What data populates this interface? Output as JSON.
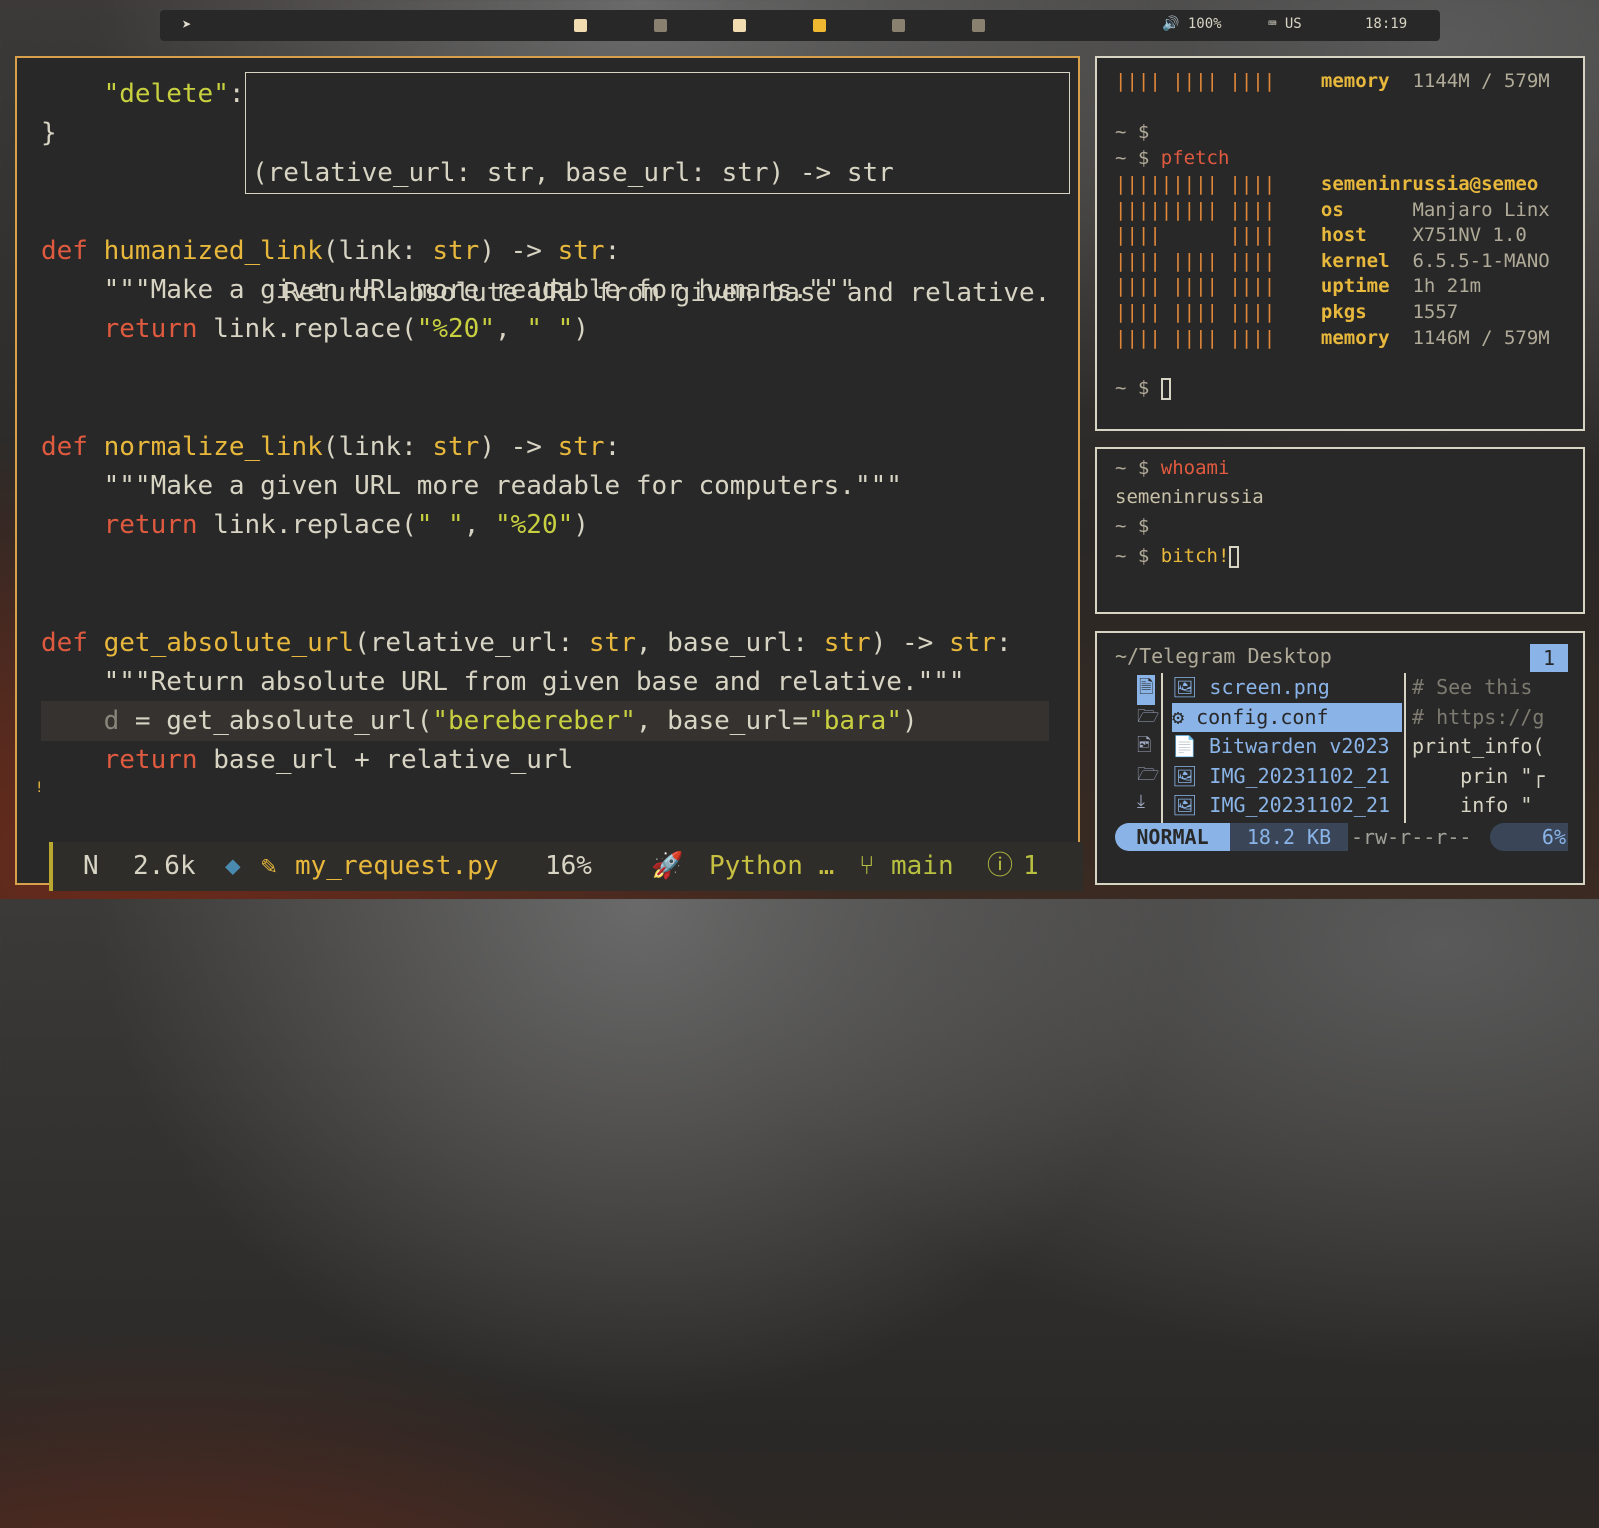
{
  "topbar": {
    "telegram_icon": "paper-plane-icon",
    "workspaces": [
      {
        "color": "#f0dcb0"
      },
      {
        "color": "#8a8070"
      },
      {
        "color": "#f0dcb0"
      },
      {
        "color": "#f0b830"
      },
      {
        "color": "#8a8070"
      },
      {
        "color": "#8a8070"
      }
    ],
    "volume": "🔊 100%",
    "keyboard": "⌨ US",
    "clock": "18:19"
  },
  "editor": {
    "lines": [
      "    \"delete\":",
      "}",
      "",
      "",
      "def humanized_link(link: str) -> str:",
      "    \"\"\"Make a given URL more readable for humans.\"\"\"",
      "    return link.replace(\"%20\", \" \")",
      "",
      "",
      "def normalize_link(link: str) -> str:",
      "    \"\"\"Make a given URL more readable for computers.\"\"\"",
      "    return link.replace(\" \", \"%20\")",
      "",
      "",
      "def get_absolute_url(relative_url: str, base_url: str) -> str:",
      "    \"\"\"Return absolute URL from given base and relative.\"\"\"",
      "    d = get_absolute_url(\"berebereber\", base_url=\"bara\")",
      "    return base_url + relative_url"
    ],
    "popup": {
      "signature": "(relative_url: str, base_url: str) -> str",
      "doc": "  Return absolute URL from given base and relative."
    },
    "warning_mark": "!",
    "status": {
      "mode": "N",
      "size": "2.6k",
      "filename": "my_request.py",
      "percent": "16%",
      "filetype": "Python …",
      "branch": "main",
      "diagnostics": "1"
    }
  },
  "term1": {
    "lines": [
      {
        "logo": "|||| |||| ||||",
        "key": "memory",
        "val": "1144M / 579M"
      },
      {
        "prompt": "~ $",
        "cmd": ""
      },
      {
        "prompt": "~ $",
        "cmd": "pfetch"
      },
      {
        "logo": "||||||||| ||||",
        "key": "semeninrussia@semeo",
        "val": ""
      },
      {
        "logo": "||||||||| ||||",
        "key": "os",
        "val": "Manjaro Linx"
      },
      {
        "logo": "||||      ||||",
        "key": "host",
        "val": "X751NV 1.0"
      },
      {
        "logo": "|||| |||| ||||",
        "key": "kernel",
        "val": "6.5.5-1-MANO"
      },
      {
        "logo": "|||| |||| ||||",
        "key": "uptime",
        "val": "1h 21m"
      },
      {
        "logo": "|||| |||| ||||",
        "key": "pkgs",
        "val": "1557"
      },
      {
        "logo": "|||| |||| ||||",
        "key": "memory",
        "val": "1146M / 579M"
      },
      {
        "prompt": "~ $",
        "cmd": ""
      }
    ]
  },
  "term2": {
    "lines": [
      {
        "prompt": "~ $",
        "cmd": "whoami"
      },
      {
        "text": "semeninrussia"
      },
      {
        "prompt": "~ $",
        "cmd": ""
      },
      {
        "prompt": "~ $",
        "cmd": "bitch!"
      }
    ]
  },
  "filemanager": {
    "path": "~/Telegram Desktop",
    "tab": "1",
    "items": [
      {
        "name": "🖼 screen.png",
        "selected": false
      },
      {
        "name": "⚙ config.conf",
        "selected": true
      },
      {
        "name": "📄 Bitwarden v2023",
        "selected": false
      },
      {
        "name": "🖼 IMG_20231102_21",
        "selected": false
      },
      {
        "name": "🖼 IMG_20231102_21",
        "selected": false
      }
    ],
    "preview": [
      {
        "text": "# See this",
        "comment": true
      },
      {
        "text": "# https://g",
        "comment": true
      },
      {
        "text": "print_info(",
        "comment": false
      },
      {
        "text": "    prin \"┌",
        "comment": false
      },
      {
        "text": "    info \"",
        "comment": false
      }
    ],
    "status": {
      "mode": "NORMAL",
      "size": "18.2 KB",
      "perms": "-rw-r--r--",
      "percent": "6%"
    }
  }
}
